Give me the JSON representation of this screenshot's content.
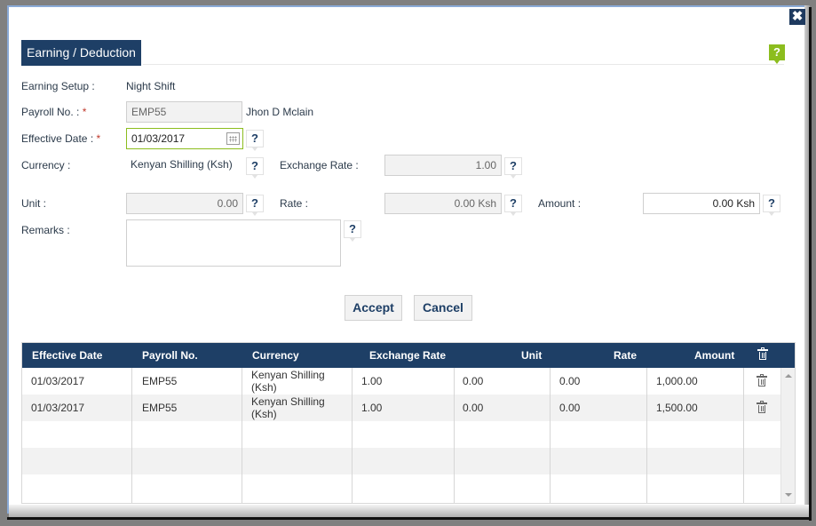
{
  "dialog": {
    "section_title": "Earning / Deduction",
    "close_icon": "close-icon",
    "help_icon": "help-icon"
  },
  "form": {
    "earning_setup": {
      "label": "Earning Setup :",
      "value": "Night Shift"
    },
    "payroll_no": {
      "label": "Payroll No. :",
      "required_mark": "*",
      "value": "EMP55",
      "employee_name": "Jhon D Mclain"
    },
    "effective_date": {
      "label": "Effective Date :",
      "required_mark": "*",
      "value": "01/03/2017"
    },
    "currency": {
      "label": "Currency :",
      "value": "Kenyan Shilling (Ksh)"
    },
    "exchange_rate": {
      "label": "Exchange Rate :",
      "value": "1.00"
    },
    "unit": {
      "label": "Unit :",
      "value": "0.00"
    },
    "rate": {
      "label": "Rate :",
      "value": "0.00 Ksh"
    },
    "amount": {
      "label": "Amount :",
      "value": "0.00 Ksh"
    },
    "remarks": {
      "label": "Remarks :",
      "value": ""
    },
    "help_glyph": "?"
  },
  "buttons": {
    "accept": "Accept",
    "cancel": "Cancel"
  },
  "grid": {
    "columns": [
      "Effective Date",
      "Payroll No.",
      "Currency",
      "Exchange Rate",
      "Unit",
      "Rate",
      "Amount"
    ],
    "rows": [
      {
        "effective_date": "01/03/2017",
        "payroll_no": "EMP55",
        "currency": "Kenyan Shilling (Ksh)",
        "exchange_rate": "1.00",
        "unit": "0.00",
        "rate": "0.00",
        "amount": "1,000.00"
      },
      {
        "effective_date": "01/03/2017",
        "payroll_no": "EMP55",
        "currency": "Kenyan Shilling (Ksh)",
        "exchange_rate": "1.00",
        "unit": "0.00",
        "rate": "0.00",
        "amount": "1,500.00"
      }
    ]
  },
  "colors": {
    "header_navy": "#1e3f66",
    "help_green": "#8cbd1e",
    "required_red": "#c0392b"
  }
}
